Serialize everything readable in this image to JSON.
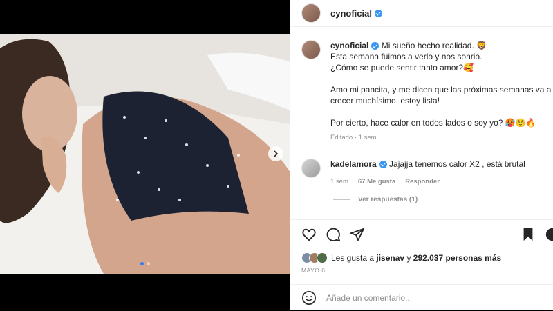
{
  "post": {
    "username": "cynoficial",
    "caption_lines": [
      "Mi sueño hecho realidad. 🦁",
      "Esta semana fuimos a verlo y nos sonrió.",
      "¿Cómo se puede sentir tanto amor?🥰",
      "Amo mi pancita, y me dicen que las próximas semanas va a",
      "crecer muchísimo, estoy lista!",
      "Por cierto, hace calor en todos lados o soy yo? 🥵☺️🔥"
    ],
    "edited_label": "Editado",
    "edited_time": "1 sem",
    "likes_prefix": "Les gusta a",
    "likes_user": "jisenav",
    "likes_conj": "y",
    "likes_count": "292.037 personas más",
    "date": "MAYO 6",
    "comment_placeholder": "Añade un comentario..."
  },
  "comment": {
    "username": "kadelamora",
    "text": "Jajajja tenemos calor X2 , está brutal",
    "time": "1 sem",
    "likes": "67 Me gusta",
    "reply": "Responder",
    "view_replies": "Ver respuestas (1)"
  },
  "icons": [
    "heart-icon",
    "comment-icon",
    "share-icon",
    "bookmark-icon",
    "more-icon",
    "emoji-icon",
    "chevron-right-icon"
  ],
  "colors": {
    "verified": "#3897f0",
    "carousel_active": "#2f7df6",
    "meta": "#8e8e8e"
  }
}
